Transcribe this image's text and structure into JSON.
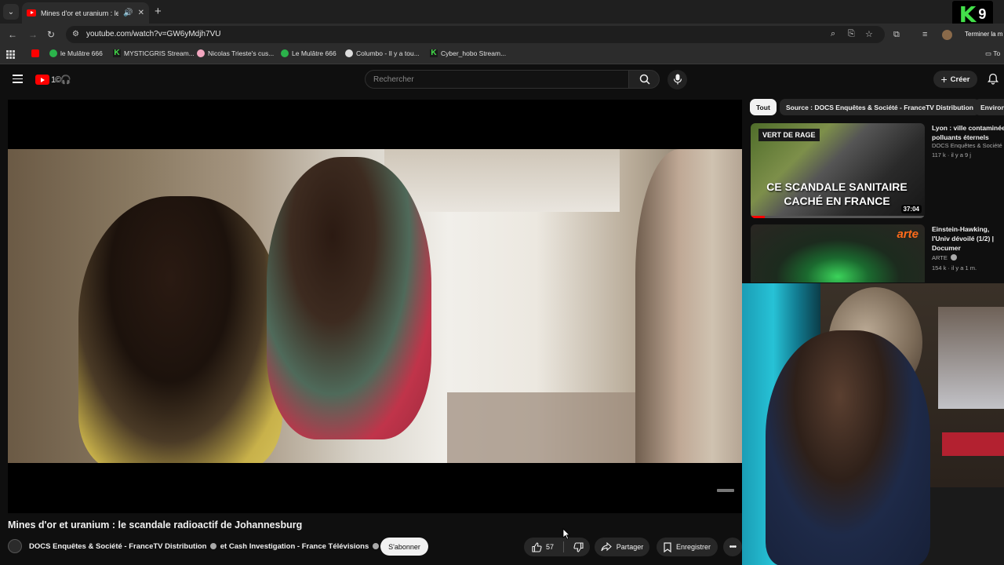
{
  "browser": {
    "tab_title": "Mines d'or et uranium : le s",
    "url": "youtube.com/watch?v=GW6yMdjh7VU",
    "overlay_badge": {
      "letter": "K",
      "number": "9"
    },
    "profile_action": "Terminer la m",
    "bookmarks": [
      {
        "label": "le Mulâtre 666",
        "icon": "green-circle-icon"
      },
      {
        "label": "MYSTICGRIS Stream...",
        "icon": "kick-icon"
      },
      {
        "label": "Nicolas Trieste's cus...",
        "icon": "pink-avatar-icon"
      },
      {
        "label": "Le Mulâtre 666",
        "icon": "green-circle-icon"
      },
      {
        "label": "Columbo - Il y a tou...",
        "icon": "ghost-icon"
      },
      {
        "label": "Cyber_hobo Stream...",
        "icon": "kick-icon"
      }
    ],
    "bookmarks_folder": "To"
  },
  "youtube": {
    "logo_text": "1©🎧",
    "search_placeholder": "Rechercher",
    "create_label": "Créer"
  },
  "video": {
    "title": "Mines d'or et uranium : le scandale radioactif de Johannesburg",
    "channel": "DOCS Enquêtes & Société - FranceTV Distribution",
    "channel_joiner": "et",
    "channel_2": "Cash Investigation - France Télévisions",
    "subscribe_label": "S'abonner",
    "likes": "57",
    "share_label": "Partager",
    "save_label": "Enregistrer"
  },
  "sidebar": {
    "chips": [
      {
        "label": "Tout",
        "active": true
      },
      {
        "label": "Source : DOCS Enquêtes & Société - FranceTV Distribution",
        "active": false
      },
      {
        "label": "Environ",
        "active": false
      }
    ],
    "recommendations": [
      {
        "title": "Lyon : ville contaminée polluants éternels",
        "channel": "DOCS Enquêtes & Société -",
        "meta": "117 k · il y a 9 j",
        "thumb_label": "VERT DE RAGE",
        "thumb_headline": "CE SCANDALE SANITAIRE CACHÉ EN FRANCE",
        "duration": "37:04",
        "watched_fraction": 0.08
      },
      {
        "title": "Einstein-Hawking, l'Univ dévoilé (1/2) | Documer",
        "channel": "ARTE",
        "meta": "154 k · il y a 1 m.",
        "thumb_label": "arte"
      }
    ]
  },
  "colors": {
    "brand_red": "#ff0000",
    "kick_green": "#43e04a",
    "background": "#0f0f0f"
  }
}
